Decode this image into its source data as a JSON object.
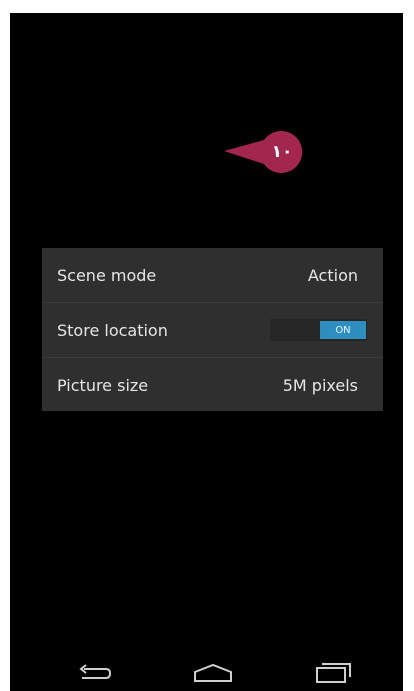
{
  "callout": {
    "label": "١٠",
    "color": "#a3264e"
  },
  "settings": {
    "rows": [
      {
        "label": "Scene mode",
        "value": "Action"
      },
      {
        "label": "Store location",
        "toggle": "ON"
      },
      {
        "label": "Picture size",
        "value": "5M pixels"
      }
    ]
  },
  "navbar": {
    "icons": [
      "back-icon",
      "home-icon",
      "recent-apps-icon"
    ]
  }
}
